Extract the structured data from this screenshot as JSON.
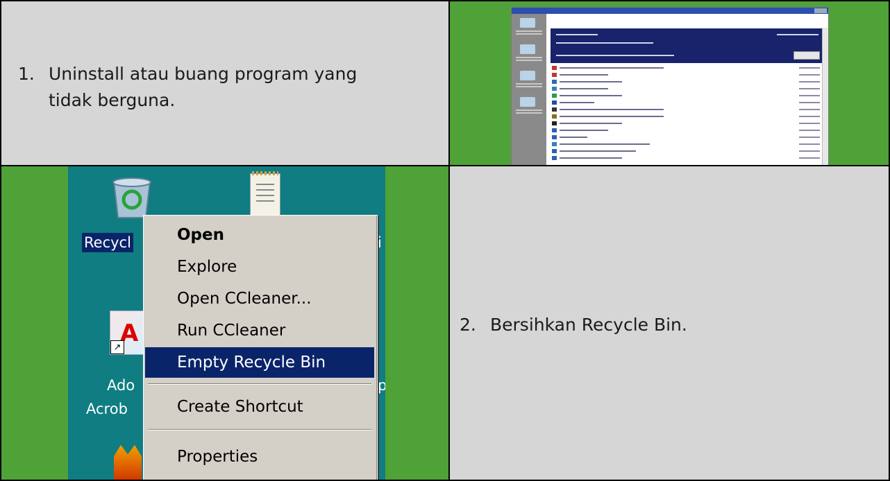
{
  "steps": [
    {
      "number": "1.",
      "line1": "Uninstall atau buang program yang",
      "line2": "tidak berguna."
    },
    {
      "number": "2.",
      "line1": "Bersihkan Recycle Bin."
    }
  ],
  "desktop": {
    "recycle_label": "Recycl",
    "adobe_label_line1": "Ado",
    "adobe_label_line2": "Acrob",
    "right_fragment_1": "i",
    "right_fragment_2": "p"
  },
  "context_menu": {
    "items": [
      {
        "label": "Open",
        "bold": true
      },
      {
        "label": "Explore"
      },
      {
        "label": "Open CCleaner..."
      },
      {
        "label": "Run CCleaner"
      },
      {
        "label": "Empty Recycle Bin",
        "highlighted": true
      },
      {
        "label": "Create Shortcut"
      },
      {
        "label": "Properties"
      }
    ]
  },
  "colors": {
    "panel_gray": "#d6d6d6",
    "panel_green": "#4fa237",
    "desktop_teal": "#0f7d82",
    "menu_highlight": "#0a246a",
    "menu_bg": "#d4d0c8"
  }
}
